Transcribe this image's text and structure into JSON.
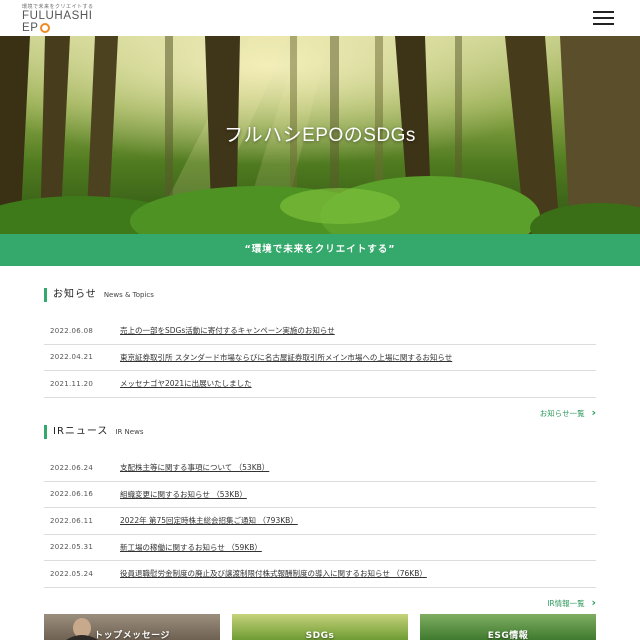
{
  "header": {
    "logo_tagline": "環境で未来をクリエイトする",
    "logo_line1": "FULUHASHI",
    "logo_line2": "EP",
    "menu_icon": "hamburger-menu-icon"
  },
  "hero": {
    "title": "フルハシEPOのSDGs"
  },
  "slogan": "“環境で未来をクリエイトする”",
  "news": {
    "title": "お知らせ",
    "subtitle": "News & Topics",
    "items": [
      {
        "date": "2022.06.08",
        "text": "売上の一部をSDGs活動に寄付するキャンペーン実施のお知らせ"
      },
      {
        "date": "2022.04.21",
        "text": "東京証券取引所 スタンダード市場ならびに名古屋証券取引所メイン市場への上場に関するお知らせ"
      },
      {
        "date": "2021.11.20",
        "text": "メッセナゴヤ2021に出展いたしました"
      }
    ],
    "more_label": "お知らせ一覧"
  },
  "ir": {
    "title": "IRニュース",
    "subtitle": "IR News",
    "items": [
      {
        "date": "2022.06.24",
        "text": "支配株主等に関する事項について （53KB）"
      },
      {
        "date": "2022.06.16",
        "text": "組織変更に関するお知らせ （53KB）"
      },
      {
        "date": "2022.06.11",
        "text": "2022年 第75回定時株主総会招集ご通知 （793KB）"
      },
      {
        "date": "2022.05.31",
        "text": "新工場の稼働に関するお知らせ （59KB）"
      },
      {
        "date": "2022.05.24",
        "text": "役員退職慰労金制度の廃止及び譲渡制限付株式報酬制度の導入に関するお知らせ （76KB）"
      }
    ],
    "more_label": "IR情報一覧"
  },
  "cards": [
    {
      "label": "トップメッセージ"
    },
    {
      "label": "SDGs"
    },
    {
      "label": "ESG情報"
    }
  ],
  "colors": {
    "accent": "#35a96c",
    "logo_orange": "#f08a24"
  }
}
